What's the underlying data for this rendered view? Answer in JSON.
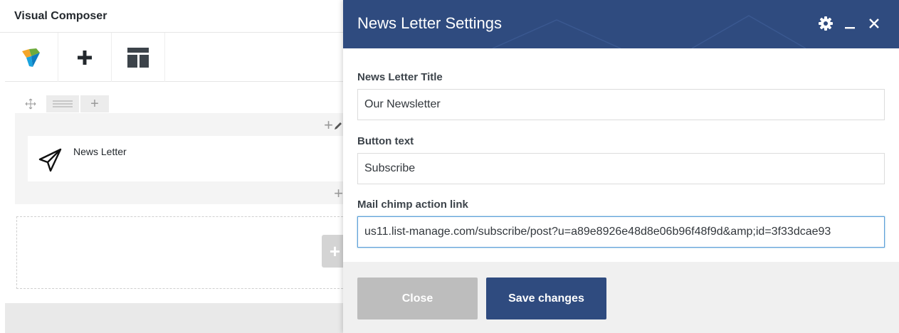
{
  "vc": {
    "title": "Visual Composer",
    "toolbar": [
      {
        "icon": "vc-logo-icon"
      },
      {
        "icon": "plus-icon"
      },
      {
        "icon": "layout-template-icon"
      }
    ],
    "row": {
      "element_label": "News Letter",
      "element_icon": "paper-plane-icon"
    }
  },
  "modal": {
    "title": "News Letter Settings",
    "header_color": "#2f4b7f",
    "fields": [
      {
        "label": "News Letter Title",
        "value": "Our Newsletter"
      },
      {
        "label": "Button text",
        "value": "Subscribe"
      },
      {
        "label": "Mail chimp action link",
        "value": "us11.list-manage.com/subscribe/post?u=a89e8926e48d8e06b96f48f9d&amp;id=3f33dcae93"
      }
    ],
    "close_label": "Close",
    "save_label": "Save changes"
  }
}
